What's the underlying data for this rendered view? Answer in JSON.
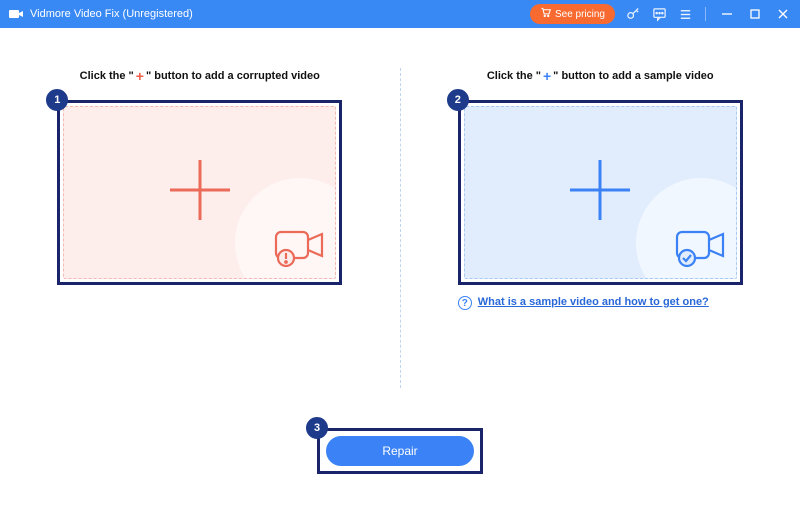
{
  "titlebar": {
    "app_title": "Vidmore Video Fix (Unregistered)",
    "pricing_label": "See pricing"
  },
  "left_panel": {
    "instruction_pre": "Click the \"",
    "instruction_plus": "+",
    "instruction_post": "\" button to add a corrupted video",
    "step": "1"
  },
  "right_panel": {
    "instruction_pre": "Click the \"",
    "instruction_plus": "+",
    "instruction_post": "\" button to add a sample video",
    "step": "2",
    "help_text": "What is a sample video and how to get one?"
  },
  "repair": {
    "step": "3",
    "label": "Repair"
  }
}
